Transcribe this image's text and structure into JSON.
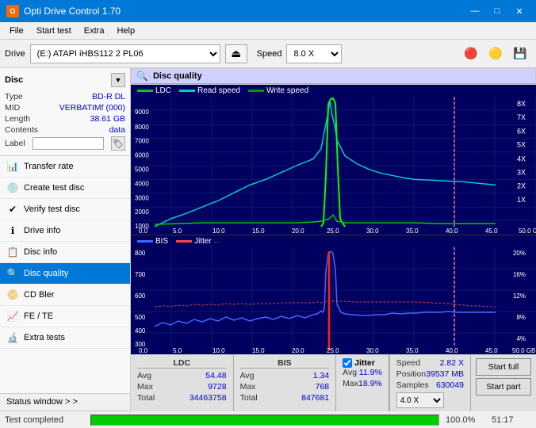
{
  "titleBar": {
    "title": "Opti Drive Control 1.70",
    "minimize": "—",
    "maximize": "□",
    "close": "✕"
  },
  "menu": {
    "items": [
      "File",
      "Start test",
      "Extra",
      "Help"
    ]
  },
  "toolbar": {
    "driveLabel": "Drive",
    "driveValue": "(E:) ATAPI iHBS112  2 PL06",
    "speedLabel": "Speed",
    "speedValue": "8.0 X"
  },
  "disc": {
    "header": "Disc",
    "type_label": "Type",
    "type_value": "BD-R DL",
    "mid_label": "MID",
    "mid_value": "VERBATIMf (000)",
    "length_label": "Length",
    "length_value": "38.61 GB",
    "contents_label": "Contents",
    "contents_value": "data",
    "label_label": "Label"
  },
  "nav": {
    "items": [
      {
        "id": "transfer-rate",
        "label": "Transfer rate",
        "icon": "📊"
      },
      {
        "id": "create-test-disc",
        "label": "Create test disc",
        "icon": "💿"
      },
      {
        "id": "verify-test-disc",
        "label": "Verify test disc",
        "icon": "✔"
      },
      {
        "id": "drive-info",
        "label": "Drive info",
        "icon": "ℹ"
      },
      {
        "id": "disc-info",
        "label": "Disc info",
        "icon": "📋"
      },
      {
        "id": "disc-quality",
        "label": "Disc quality",
        "icon": "🔍",
        "active": true
      },
      {
        "id": "cd-bler",
        "label": "CD Bler",
        "icon": "📀"
      },
      {
        "id": "fe-te",
        "label": "FE / TE",
        "icon": "📈"
      },
      {
        "id": "extra-tests",
        "label": "Extra tests",
        "icon": "🔬"
      }
    ],
    "statusWindow": "Status window > >"
  },
  "discQuality": {
    "header": "Disc quality",
    "legend": {
      "ldc": "LDC",
      "readSpeed": "Read speed",
      "writeSpeed": "Write speed",
      "bis": "BIS",
      "jitter": "Jitter"
    }
  },
  "stats": {
    "ldc_header": "LDC",
    "bis_header": "BIS",
    "jitter_header": "Jitter",
    "speed_header": "Speed",
    "avg_label": "Avg",
    "max_label": "Max",
    "total_label": "Total",
    "position_label": "Position",
    "samples_label": "Samples",
    "ldc_avg": "54.48",
    "ldc_max": "9728",
    "ldc_total": "34463758",
    "bis_avg": "1.34",
    "bis_max": "768",
    "bis_total": "847681",
    "jitter_avg": "11.9%",
    "jitter_max": "18.9%",
    "speed_value": "2.82 X",
    "position_value": "39537 MB",
    "samples_value": "630049",
    "speed_select": "4.0 X",
    "start_full": "Start full",
    "start_part": "Start part"
  },
  "statusBar": {
    "text": "Test completed",
    "progress": "100.0%",
    "progressPct": 100,
    "time": "51:17"
  },
  "colors": {
    "ldc": "#00cc00",
    "readSpeed": "#00cccc",
    "writeSpeed": "#009900",
    "bis": "#4466ff",
    "jitter": "#ff4444",
    "chartBg": "#000060",
    "gridLine": "#002060",
    "pink": "#ff69b4"
  }
}
